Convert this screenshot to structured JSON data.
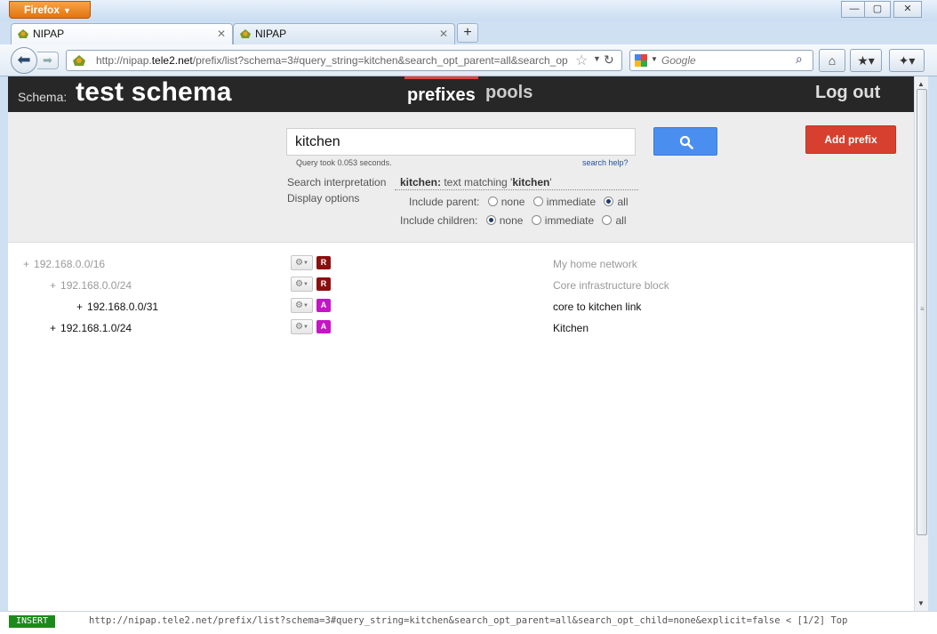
{
  "browser": {
    "menu_button": "Firefox",
    "tabs": [
      {
        "label": "NIPAP",
        "active": true
      },
      {
        "label": "NIPAP",
        "active": false
      }
    ],
    "url_prefix": "http://nipap.",
    "url_domain": "tele2.net",
    "url_path": "/prefix/list?schema=3#query_string=kitchen&search_opt_parent=all&search_op",
    "search_engine": "Google"
  },
  "header": {
    "schema_label": "Schema:",
    "schema_name": "test schema",
    "nav": {
      "prefixes": "prefixes",
      "pools": "pools"
    },
    "logout": "Log out"
  },
  "search": {
    "query": "kitchen",
    "query_time": "Query took 0.053 seconds.",
    "help_link": "search help?",
    "add_prefix": "Add prefix",
    "interpretation_label": "Search interpretation",
    "interpretation_term": "kitchen:",
    "interpretation_text": " text matching '",
    "interpretation_match": "kitchen",
    "interpretation_end": "'",
    "display_options_label": "Display options",
    "include_parent_label": "Include parent:",
    "include_children_label": "Include children:",
    "options": {
      "none": "none",
      "immediate": "immediate",
      "all": "all"
    },
    "include_parent_selected": "all",
    "include_children_selected": "none"
  },
  "prefixes": [
    {
      "prefix": "192.168.0.0/16",
      "type": "R",
      "description": "My home network",
      "match": false
    },
    {
      "prefix": "192.168.0.0/24",
      "type": "R",
      "description": "Core infrastructure block",
      "match": false
    },
    {
      "prefix": "192.168.0.0/31",
      "type": "A",
      "description": "core to kitchen link",
      "match": true
    },
    {
      "prefix": "192.168.1.0/24",
      "type": "A",
      "description": "Kitchen",
      "match": true
    }
  ],
  "type_colors": {
    "R": "#8b0f0f",
    "A": "#c515c5"
  },
  "statusbar": {
    "mode": "INSERT",
    "url": "http://nipap.tele2.net/prefix/list?schema=3#query_string=kitchen&search_opt_parent=all&search_opt_child=none&explicit=false < [1/2] Top"
  }
}
